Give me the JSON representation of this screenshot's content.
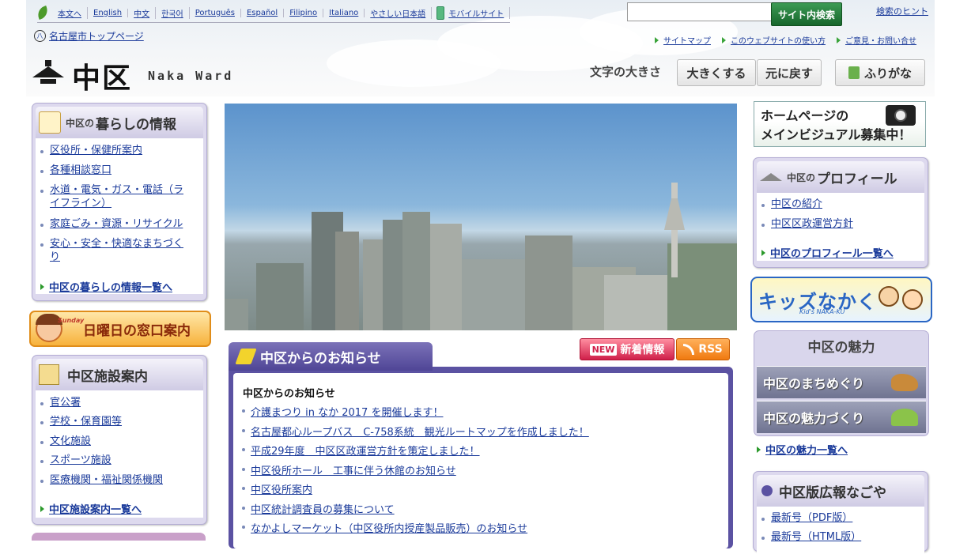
{
  "languages": [
    "本文へ",
    "English",
    "中文",
    "한국어",
    "Português",
    "Español",
    "Filipino",
    "Italiano",
    "やさしい日本語",
    "モバイルサイト"
  ],
  "search": {
    "button_label": "サイト内検索",
    "hint_label": "検索のヒント",
    "value": ""
  },
  "top_link": "名古屋市トップページ",
  "utility_links": [
    "サイトマップ",
    "このウェブサイトの使い方",
    "ご意見・お問い合せ"
  ],
  "logo": {
    "kanji": "中区",
    "english": "Naka Ward"
  },
  "font_size": {
    "label": "文字の大きさ",
    "bigger": "大きくする",
    "reset": "元に戻す",
    "furigana": "ふりがな"
  },
  "living": {
    "prefix": "中区の",
    "title": "暮らしの情報",
    "items": [
      "区役所・保健所案内",
      "各種相談窓口",
      "水道・電気・ガス・電話（ライフライン）",
      "家庭ごみ・資源・リサイクル",
      "安心・安全・快適なまちづくり"
    ],
    "more": "中区の暮らしの情報一覧へ"
  },
  "sunday_banner": {
    "badge": "Sunday",
    "label": "日曜日の窓口案内"
  },
  "facilities": {
    "title": "中区施設案内",
    "items": [
      "官公署",
      "学校・保育園等",
      "文化施設",
      "スポーツ施設",
      "医療機関・福祉関係機関"
    ],
    "more": "中区施設案内一覧へ"
  },
  "news": {
    "tab_title": "中区からのお知らせ",
    "new_badge": "NEW",
    "new_label": "新着情報",
    "rss_label": "RSS",
    "heading": "中区からのお知らせ",
    "items": [
      "介護まつり in なか 2017 を開催します！",
      "名古屋都心ループバス　C-758系統　観光ルートマップを作成しました！",
      "平成29年度　中区区政運営方針を策定しました！",
      "中区役所ホール　工事に伴う休館のお知らせ",
      "中区役所案内",
      "中区統計調査員の募集について",
      "なかよしマーケット（中区役所内授産製品販売）のお知らせ"
    ]
  },
  "visual_banner": {
    "line1": "ホームページの",
    "line2": "メインビジュアル募集中！"
  },
  "profile": {
    "prefix": "中区の",
    "title": "プロフィール",
    "items": [
      "中区の紹介",
      "中区区政運営方針"
    ],
    "more": "中区のプロフィール一覧へ"
  },
  "kids_banner": {
    "title": "キッズなかく",
    "subtitle": "Kid's NAKA-KU"
  },
  "charm": {
    "title": "中区の魅力",
    "buttons": [
      "中区のまちめぐり",
      "中区の魅力づくり"
    ],
    "more": "中区の魅力一覧へ"
  },
  "koho": {
    "title": "中区版広報なごや",
    "items": [
      "最新号（PDF版）",
      "最新号（HTML版）"
    ]
  }
}
